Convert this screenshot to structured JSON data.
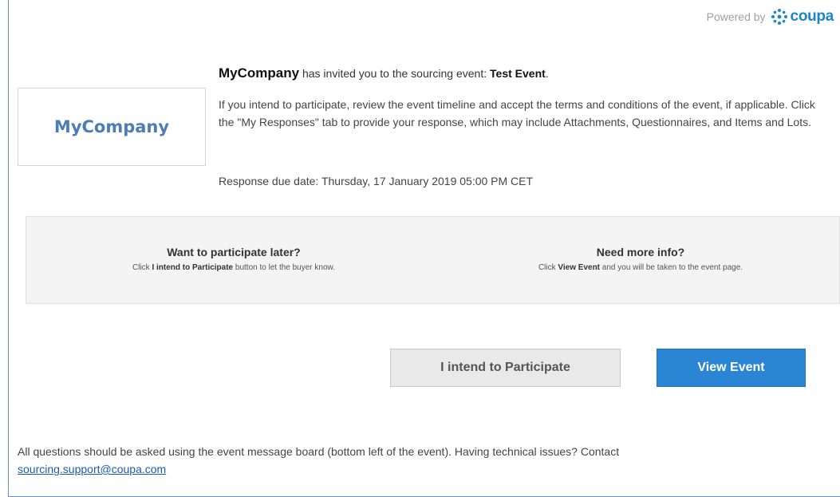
{
  "header": {
    "powered_by": "Powered by",
    "brand": "coupa",
    "brand_color": "#1a85c9"
  },
  "logo": {
    "company_name": "MyCompany"
  },
  "invite": {
    "company": "MyCompany",
    "text": "has invited you to the sourcing event:",
    "event_name": "Test Event",
    "period": "."
  },
  "body": {
    "paragraph": "If you intend to participate, review the event timeline and accept the terms and conditions of the event, if applicable. Click the \"My Responses\" tab to provide your response, which may include Attachments, Questionnaires, and Items and Lots.",
    "due_date": "Response due date: Thursday, 17 January 2019 05:00 PM CET"
  },
  "info": {
    "left": {
      "title": "Want to participate later?",
      "prefix": "Click",
      "bold": "I intend to Participate",
      "suffix": "button to let the buyer know."
    },
    "right": {
      "title": "Need more info?",
      "prefix": "Click",
      "bold": "View Event",
      "suffix": "and you will be taken to the event page."
    }
  },
  "buttons": {
    "participate": "I intend to Participate",
    "view_event": "View Event",
    "primary_color": "#2a86d4"
  },
  "footer": {
    "text": "All questions should be asked using the event message board (bottom left of the event). Having technical issues? Contact",
    "email": "sourcing.support@coupa.com"
  }
}
